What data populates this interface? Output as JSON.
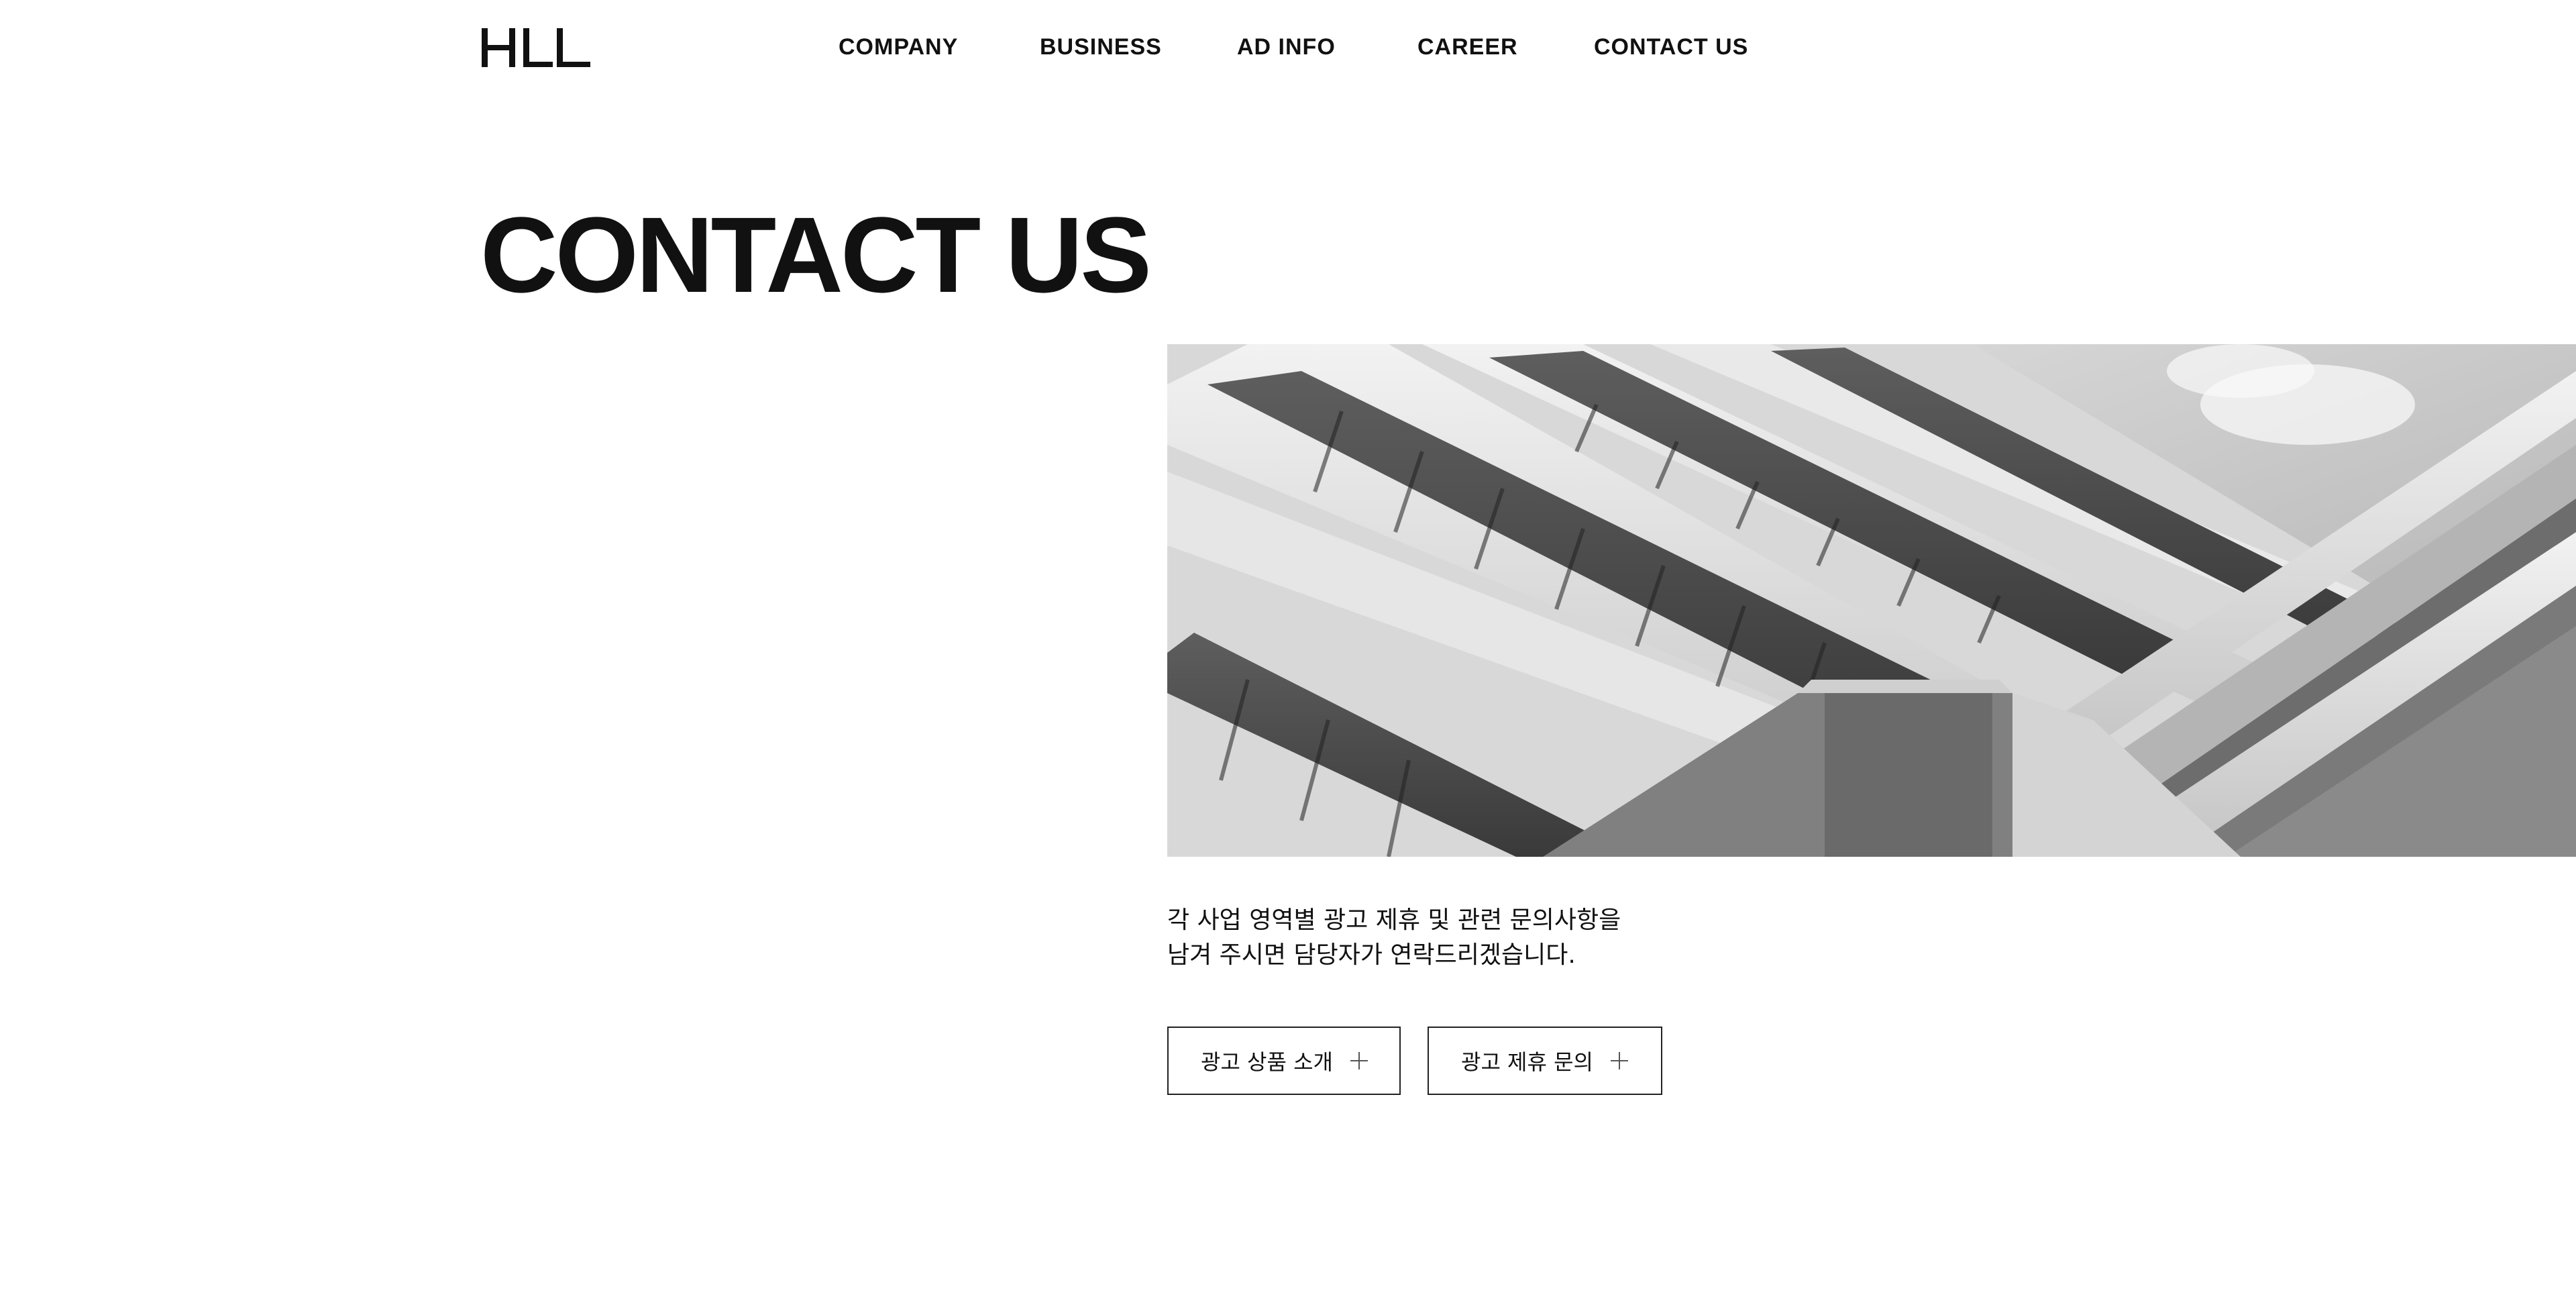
{
  "header": {
    "logo_text": "HLL",
    "nav": [
      {
        "label": "COMPANY"
      },
      {
        "label": "BUSINESS"
      },
      {
        "label": "AD INFO"
      },
      {
        "label": "CAREER"
      },
      {
        "label": "CONTACT US"
      }
    ]
  },
  "main": {
    "title": "CONTACT US",
    "hero_image": "building-photo",
    "description": [
      "각 사업 영역별 광고 제휴 및 관련 문의사항을",
      "남겨 주시면 담당자가 연락드리겠습니다."
    ],
    "buttons": [
      {
        "label": "광고 상품 소개",
        "icon": "plus-icon"
      },
      {
        "label": "광고 제휴 문의",
        "icon": "plus-icon"
      }
    ]
  }
}
